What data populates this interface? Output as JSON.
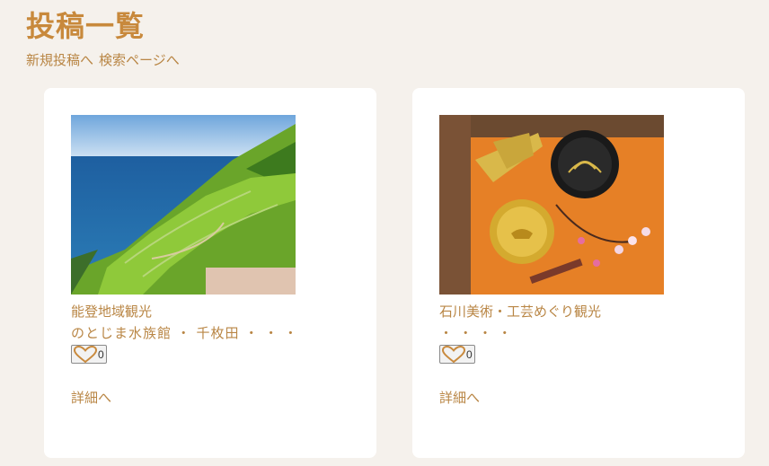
{
  "header": {
    "title": "投稿一覧",
    "links": [
      "新規投稿へ",
      "検索ページへ"
    ]
  },
  "posts": [
    {
      "image": "coastal terraced rice fields",
      "title": "能登地域観光",
      "description": "のとじま水族館 ・ 千枚田 ・ ・ ・",
      "likes": "0",
      "detail_link": "詳細へ"
    },
    {
      "image": "lacquerware plates with folding fans and plum blossoms",
      "title": "石川美術・工芸めぐり観光",
      "description": "・ ・ ・ ・",
      "likes": "0",
      "detail_link": "詳細へ"
    }
  ],
  "colors": {
    "background": "#f5f1ec",
    "accent": "#c8893c",
    "text": "#b98645",
    "card": "#ffffff"
  },
  "icons": {
    "like": "heart-icon"
  }
}
